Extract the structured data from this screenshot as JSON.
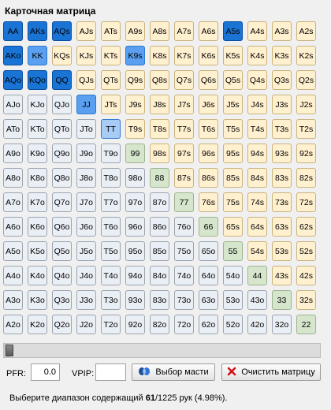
{
  "title": "Карточная матрица",
  "ranks": [
    "A",
    "K",
    "Q",
    "J",
    "T",
    "9",
    "8",
    "7",
    "6",
    "5",
    "4",
    "3",
    "2"
  ],
  "colors": {
    "pair": "#eef1f4",
    "suited": "#fff0cf",
    "offsuit": "#eaeff5",
    "green": "#d6e6cd",
    "dark": "#1a74d6",
    "mid": "#5a9ff0",
    "light": "#a8ccf5"
  },
  "highlight": {
    "AA": "dark",
    "AKs": "dark",
    "AQs": "dark",
    "A5s": "dark",
    "AKo": "dark",
    "AQo": "dark",
    "KQo": "dark",
    "QQ": "dark",
    "KK": "mid",
    "K9s": "mid",
    "JJ": "mid",
    "TT": "light"
  },
  "green_pairs": [
    "99",
    "88",
    "77",
    "66",
    "55",
    "44",
    "33",
    "22"
  ],
  "slider": {
    "fraction": 0.0
  },
  "controls": {
    "pfr_label": "PFR:",
    "pfr_value": "0.0",
    "vpip_label": "VPIP:",
    "vpip_value": "",
    "suit_button": "Выбор масти",
    "suit_icon": "card-suits-icon",
    "clear_button": "Очистить матрицу",
    "clear_icon": "red-x-icon"
  },
  "status": {
    "prefix": "Выберите диапазон содержащий ",
    "selected": "61",
    "total": "/1225 рук (4.98%)."
  }
}
